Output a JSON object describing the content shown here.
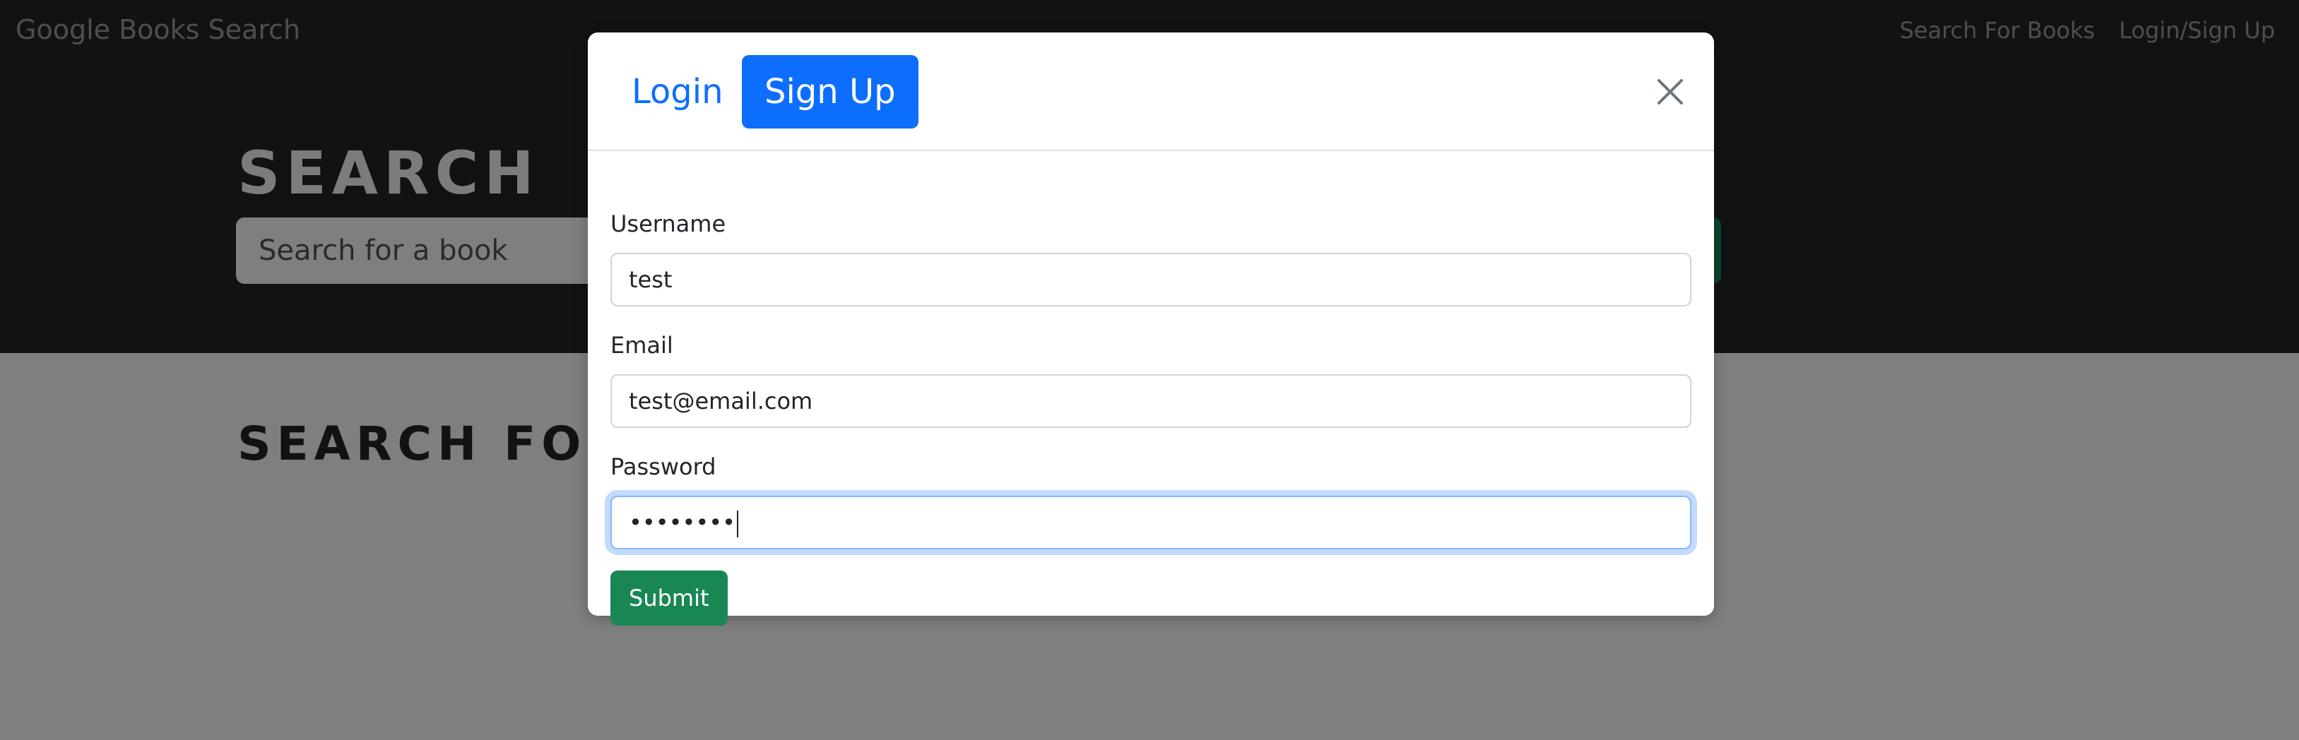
{
  "navbar": {
    "brand": "Google Books Search",
    "links": [
      "Search For Books",
      "Login/Sign Up"
    ]
  },
  "hero": {
    "title": "SEARCH",
    "search_placeholder": "Search for a book"
  },
  "section": {
    "title": "SEARCH FO"
  },
  "modal": {
    "tabs": {
      "login": "Login",
      "signup": "Sign Up"
    },
    "active_tab": "Sign Up",
    "fields": {
      "username": {
        "label": "Username",
        "value": "test"
      },
      "email": {
        "label": "Email",
        "value": "test@email.com"
      },
      "password": {
        "label": "Password",
        "value": "••••••••"
      }
    },
    "submit_label": "Submit"
  },
  "colors": {
    "primary": "#0d6efd",
    "success": "#198754",
    "dark": "#212529"
  },
  "icons": {
    "close": "close-icon"
  }
}
